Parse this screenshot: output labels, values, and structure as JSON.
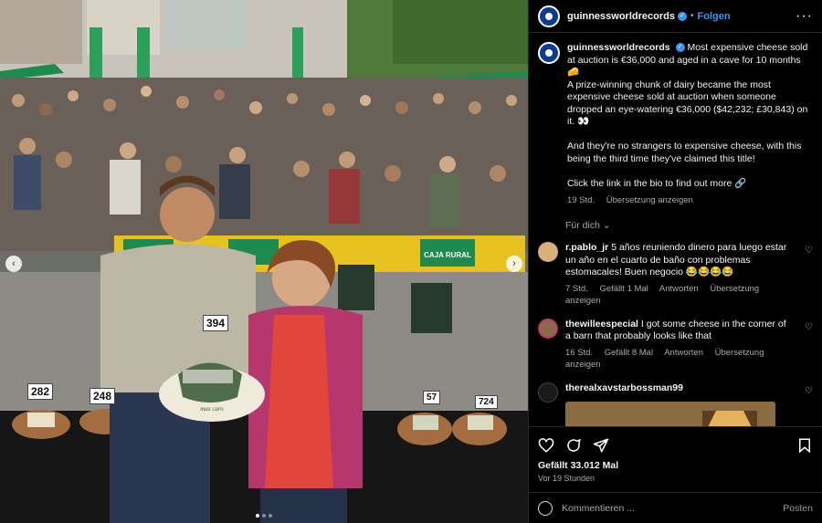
{
  "header": {
    "username": "guinnessworldrecords",
    "follow_label": "Folgen",
    "more_icon": "more-horizontal-icon"
  },
  "photo": {
    "tags": [
      "394",
      "282",
      "248",
      "57",
      "724"
    ],
    "banner_text": "CAJA RURAL",
    "plate_text": "mas caro"
  },
  "caption": {
    "username": "guinnessworldrecords",
    "text_1": "Most expensive cheese sold at auction is €36,000 and aged in a cave for 10 months 🧀",
    "text_2": "A prize-winning chunk of dairy became the most expensive cheese sold at auction when someone dropped an eye-watering €36,000 ($42,232; £30,843) on it. 👀",
    "text_3": "And they're no strangers to expensive cheese, with this being the third time they've claimed this title!",
    "text_4": "Click the link in the bio to find out more 🔗",
    "time": "19 Std.",
    "translate": "Übersetzung anzeigen"
  },
  "see_all": "Für dich ⌄",
  "comments": [
    {
      "username": "r.pablo_jr",
      "text": "5 años reuniendo dinero para luego estar un año en el cuarto de baño con problemas estomacales! Buen negocio 😂😂😂😂",
      "time": "7 Std.",
      "likes": "Gefällt 1 Mal",
      "reply": "Antworten",
      "translate": "Übersetzung anzeigen"
    },
    {
      "username": "thewillеespecial",
      "text": "I got some cheese in the corner of a barn that probably looks like that",
      "time": "16 Std.",
      "likes": "Gefällt 8 Mal",
      "reply": "Antworten",
      "translate": "Übersetzung anzeigen"
    },
    {
      "username": "therealxavstarbossman99",
      "text": ""
    }
  ],
  "actions": {
    "likes": "Gefällt 33.012 Mal",
    "ago": "Vor 19 Stunden"
  },
  "comment_box": {
    "placeholder": "Kommentieren ...",
    "post_label": "Posten"
  }
}
